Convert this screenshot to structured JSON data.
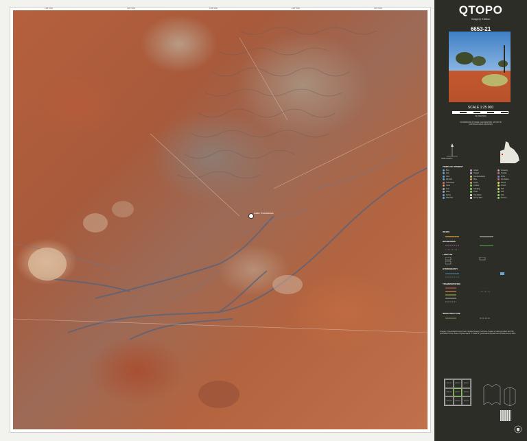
{
  "map": {
    "grid_ticks_top": [
      "138°20'E",
      "138°30'E",
      "138°40'E",
      "138°50'E",
      "139°00'E"
    ],
    "feature_label": "Lake Constance",
    "colors": {
      "desert_red": "#b5603c",
      "claypan": "#d8b998",
      "drainage_blue": "#5a6a86"
    }
  },
  "sidebar": {
    "brand_title": "QTOPO",
    "brand_subtitle": "Imagery Edition",
    "map_number": "6653-21",
    "scale_text": "SCALE 1:25 000",
    "scale_units": "KILOMETRES",
    "projection_note": "COORDINATE SYSTEM: GEOCENTRIC DATUM OF AUSTRALIA 2020 (GDA2020)",
    "north_note": "GRID NORTH",
    "legend_heading_roads": "ROADS",
    "legend_heading_boundaries": "BOUNDARIES",
    "legend_heading_landuse": "LAND USE",
    "legend_heading_hydrography": "HYDROGRAPHY",
    "legend_heading_transportation": "TRANSPORTATION",
    "legend_heading_infrastructure": "INFRASTRUCTURE",
    "legend_heading_points": "POINTS OF INTEREST",
    "legend_items_col1": [
      "Bore",
      "Dam",
      "Tank",
      "Windmill",
      "Homestead",
      "Yards",
      "Ruin",
      "Cave",
      "Spring",
      "Waterhole"
    ],
    "legend_items_col2": [
      "Airfield",
      "Helipad",
      "Communications",
      "Mine",
      "Quarry",
      "Lookout",
      "Camping",
      "Picnic",
      "Trig Station",
      "Survey Mark"
    ],
    "legend_items_col3": [
      "Cemetery",
      "Hospital",
      "Police",
      "Fire Station",
      "School",
      "Church",
      "Hall",
      "Golf",
      "Park",
      "Reserve"
    ],
    "disclaimer": "Imagery: Queensland Government Spatial Imagery Services. Based on data provided with the permission of the State of Queensland. © State of Queensland (Department of Resources) 2024.",
    "index_labels": [
      "6653-11",
      "6653-12",
      "6653-13",
      "6653-14",
      "6653-21",
      "6653-22",
      "6653-23",
      "6653-24",
      "6653-31"
    ]
  }
}
